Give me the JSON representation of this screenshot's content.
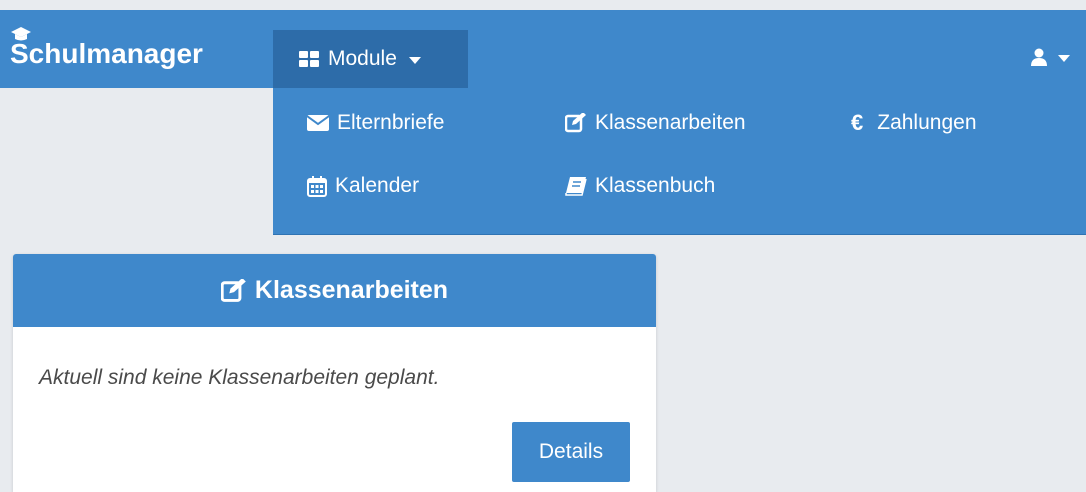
{
  "navbar": {
    "brand": "Schulmanager",
    "module_label": "Module",
    "icons": {
      "brand": "graduation-cap-icon",
      "module": "th-large-icon",
      "user": "user-icon"
    }
  },
  "dropdown": {
    "items": [
      {
        "label": "Elternbriefe",
        "icon": "envelope-icon"
      },
      {
        "label": "Klassenarbeiten",
        "icon": "edit-icon"
      },
      {
        "label": "Zahlungen",
        "icon": "euro-icon",
        "glyph": "€"
      },
      {
        "label": "Kalender",
        "icon": "calendar-icon"
      },
      {
        "label": "Klassenbuch",
        "icon": "book-icon"
      }
    ]
  },
  "card": {
    "title": "Klassenarbeiten",
    "text": "Aktuell sind keine Klassenarbeiten geplant.",
    "button": "Details"
  },
  "colors": {
    "primary": "#3f88cb",
    "active": "#2d6ca9",
    "background": "#e8ebef"
  }
}
